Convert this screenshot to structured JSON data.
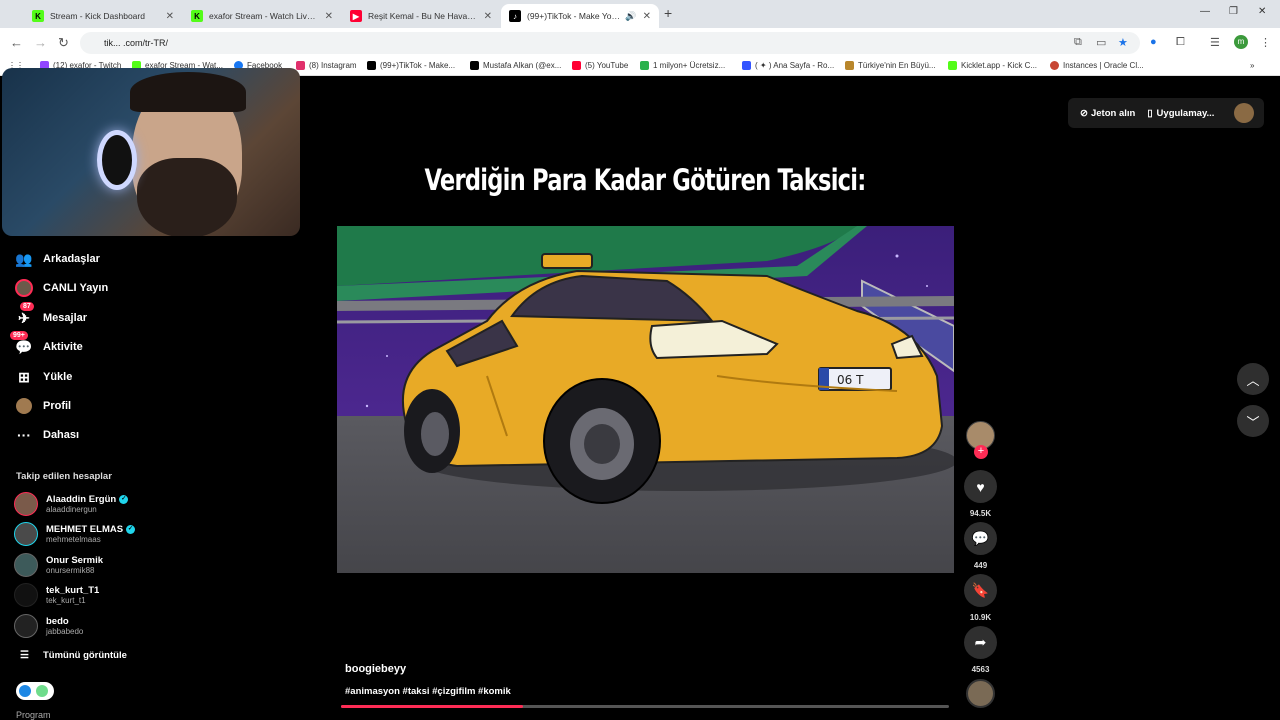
{
  "browser": {
    "tabs": [
      {
        "title": "Stream - Kick Dashboard",
        "icon": "kick-icon",
        "color": "#53fc18",
        "active": false
      },
      {
        "title": "exafor Stream - Watch Live on",
        "icon": "kick-icon",
        "color": "#53fc18",
        "active": false
      },
      {
        "title": "Reşit Kemal - Bu Ne Hava (Offic",
        "icon": "youtube-icon",
        "color": "#ff0033",
        "active": false
      },
      {
        "title": "(99+)TikTok - Make Your D",
        "icon": "tiktok-icon",
        "color": "#000000",
        "active": true
      }
    ],
    "address": "tik... .com/tr-TR/",
    "bookmarks": [
      {
        "label": "(12) exafor - Twitch",
        "color": "#9146ff"
      },
      {
        "label": "exafor Stream - Wat...",
        "color": "#53fc18"
      },
      {
        "label": "Facebook",
        "color": "#1877f2"
      },
      {
        "label": "(8) Instagram",
        "color": "#e1306c"
      },
      {
        "label": "(99+)TikTok - Make...",
        "color": "#000000"
      },
      {
        "label": "Mustafa Alkan (@ex...",
        "color": "#000000"
      },
      {
        "label": "(5) YouTube",
        "color": "#ff0033"
      },
      {
        "label": "1 milyon+ Ücretsiz...",
        "color": "#2ab24c"
      },
      {
        "label": "( ✦ ) Ana Sayfa - Ro...",
        "color": "#3355ff"
      },
      {
        "label": "Türkiye'nin En Büyü...",
        "color": "#b8862b"
      },
      {
        "label": "Kicklet.app - Kick C...",
        "color": "#53fc18"
      },
      {
        "label": "Instances | Oracle Cl...",
        "color": "#c74634"
      }
    ]
  },
  "sidebar": {
    "nav": [
      {
        "label": "Arkadaşlar",
        "icon": "friends-icon",
        "badge": ""
      },
      {
        "label": "CANLI Yayın",
        "icon": "live-icon",
        "badge": ""
      },
      {
        "label": "Mesajlar",
        "icon": "messages-icon",
        "badge": "87"
      },
      {
        "label": "Aktivite",
        "icon": "activity-icon",
        "badge": "99+"
      },
      {
        "label": "Yükle",
        "icon": "upload-icon",
        "badge": ""
      },
      {
        "label": "Profil",
        "icon": "profile-icon",
        "badge": ""
      },
      {
        "label": "Dahası",
        "icon": "more-icon",
        "badge": ""
      }
    ],
    "following_title": "Takip edilen hesaplar",
    "following": [
      {
        "name": "Alaaddin Ergün",
        "handle": "alaaddinergun",
        "verified": true
      },
      {
        "name": "MEHMET ELMAS",
        "handle": "mehmetelmaas",
        "verified": true
      },
      {
        "name": "Onur Sermik",
        "handle": "onursermik88",
        "verified": false
      },
      {
        "name": "tek_kurt_T1",
        "handle": "tek_kurt_t1",
        "verified": false
      },
      {
        "name": "bedo",
        "handle": "jabbabedo",
        "verified": false
      }
    ],
    "see_all": "Tümünü görüntüle",
    "program": "Program"
  },
  "header": {
    "coins": "Jeton alın",
    "app": "Uygulamay..."
  },
  "video": {
    "title": "Verdiğin Para Kadar Götüren Taksici:",
    "plate": "06 T",
    "author": "boogiebeyy",
    "tags": "#animasyon #taksi #çizgifilm #komik",
    "progress": 0.3
  },
  "actions": {
    "likes": "94.5K",
    "comments": "449",
    "saves": "10.9K",
    "shares": "4563"
  },
  "colors": {
    "accent": "#fe2c55",
    "verified": "#20d5ec"
  }
}
